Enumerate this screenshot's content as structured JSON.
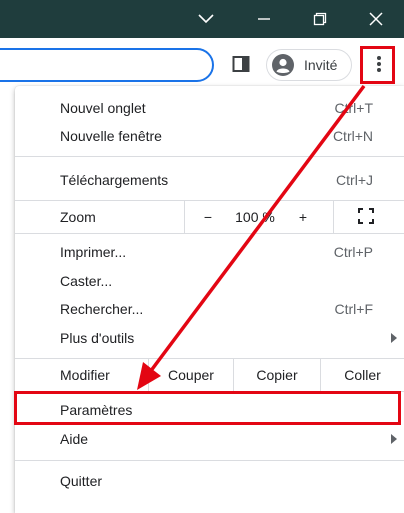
{
  "titlebar": {
    "bg_color": "#1f3d3d",
    "controls": [
      "chevron-down-icon",
      "minimize-icon",
      "restore-icon",
      "close-icon"
    ]
  },
  "toolbar": {
    "profile_label": "Invité"
  },
  "menu": {
    "new_tab": {
      "label": "Nouvel onglet",
      "shortcut": "Ctrl+T"
    },
    "new_window": {
      "label": "Nouvelle fenêtre",
      "shortcut": "Ctrl+N"
    },
    "downloads": {
      "label": "Téléchargements",
      "shortcut": "Ctrl+J"
    },
    "zoom": {
      "label": "Zoom",
      "minus": "−",
      "value": "100 %",
      "plus": "+"
    },
    "print": {
      "label": "Imprimer...",
      "shortcut": "Ctrl+P"
    },
    "cast": {
      "label": "Caster..."
    },
    "find": {
      "label": "Rechercher...",
      "shortcut": "Ctrl+F"
    },
    "more_tools": {
      "label": "Plus d'outils"
    },
    "edit": {
      "label": "Modifier",
      "cut": "Couper",
      "copy": "Copier",
      "paste": "Coller"
    },
    "settings": {
      "label": "Paramètres"
    },
    "help": {
      "label": "Aide"
    },
    "quit": {
      "label": "Quitter"
    }
  },
  "annotation": {
    "color": "#e30613"
  }
}
